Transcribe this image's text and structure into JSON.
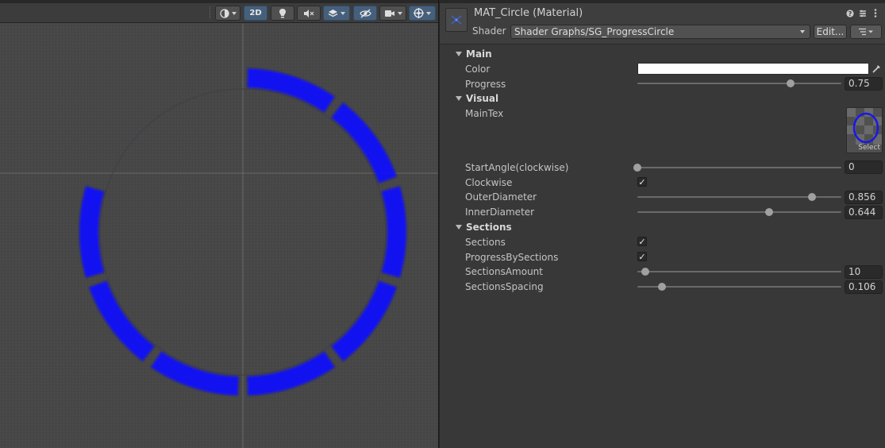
{
  "scene": {
    "toolbar": {
      "shading_icon": "circle-shading-icon",
      "mode_2d_label": "2D",
      "lighting_icon": "bulb-icon",
      "audio_icon": "speaker-mute-icon",
      "effects_icon": "layers-icon",
      "hidden_icon": "eye-slash-icon",
      "camera_icon": "camera-icon",
      "gizmos_icon": "gizmo-globe-icon"
    },
    "colors": {
      "ring": "#0a0aff",
      "background": "#484848"
    }
  },
  "inspector": {
    "title": "MAT_Circle (Material)",
    "shader_label": "Shader",
    "shader_value": "Shader Graphs/SG_ProgressCircle",
    "edit_label": "Edit...",
    "header_icons": [
      "help-icon",
      "preset-icon",
      "more-icon"
    ],
    "sections": {
      "main": {
        "label": "Main",
        "color_label": "Color",
        "color_value": "#ffffff",
        "progress_label": "Progress",
        "progress_value": "0.75",
        "progress_fraction": 0.75
      },
      "visual": {
        "label": "Visual",
        "maintex_label": "MainTex",
        "select_label": "Select",
        "start_angle_label": "StartAngle(clockwise)",
        "start_angle_value": "0",
        "start_angle_fraction": 0,
        "clockwise_label": "Clockwise",
        "clockwise_checked": true,
        "outer_label": "OuterDiameter",
        "outer_value": "0.856",
        "outer_fraction": 0.856,
        "inner_label": "InnerDiameter",
        "inner_value": "0.644",
        "inner_fraction": 0.644
      },
      "sections": {
        "label": "Sections",
        "sections_label": "Sections",
        "sections_checked": true,
        "pbs_label": "ProgressBySections",
        "pbs_checked": true,
        "amount_label": "SectionsAmount",
        "amount_value": "10",
        "amount_fraction": 0.04,
        "spacing_label": "SectionsSpacing",
        "spacing_value": "0.106",
        "spacing_fraction": 0.12
      }
    }
  }
}
